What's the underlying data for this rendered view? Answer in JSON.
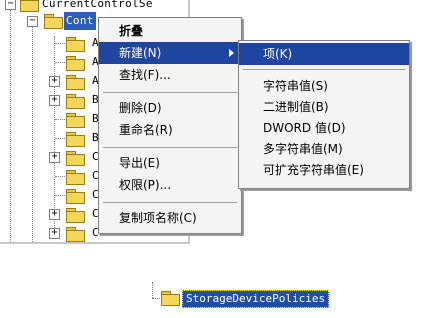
{
  "tree": {
    "root_label": "CurrentControlSe",
    "selected_label": "Cont",
    "rows": [
      "A",
      "A",
      "A",
      "B",
      "B",
      "B",
      "C",
      "C",
      "C",
      "C"
    ],
    "last_label": "ContentInd"
  },
  "context_menu": {
    "items": [
      {
        "label": "折叠"
      },
      {
        "label": "新建(N)"
      },
      {
        "label": "查找(F)..."
      },
      {
        "label": "删除(D)"
      },
      {
        "label": "重命名(R)"
      },
      {
        "label": "导出(E)"
      },
      {
        "label": "权限(P)..."
      },
      {
        "label": "复制项名称(C)"
      }
    ]
  },
  "submenu": {
    "items": [
      {
        "label": "项(K)"
      },
      {
        "label": "字符串值(S)"
      },
      {
        "label": "二进制值(B)"
      },
      {
        "label": "DWORD 值(D)"
      },
      {
        "label": "多字符串值(M)"
      },
      {
        "label": "可扩充字符串值(E)"
      }
    ]
  },
  "new_key": {
    "label": "StorageDevicePolicies"
  },
  "colors": {
    "highlight": "#1e46a0",
    "selection": "#2f5fb3",
    "folder": "#f4d65a"
  }
}
